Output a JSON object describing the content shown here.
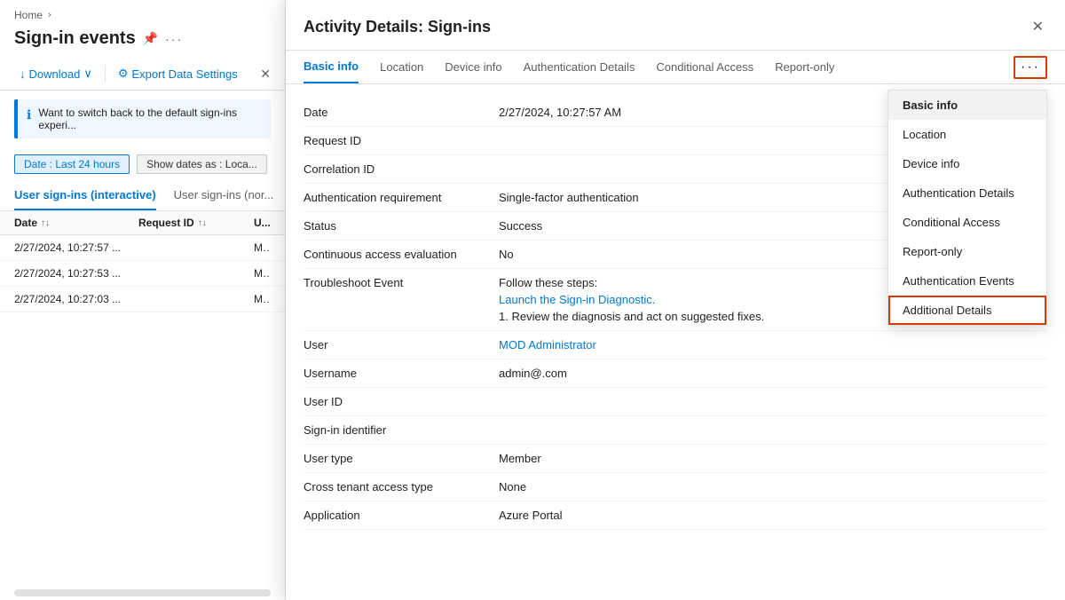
{
  "breadcrumb": {
    "home": "Home",
    "separator": "›"
  },
  "leftPanel": {
    "pageTitle": "Sign-in events",
    "toolbar": {
      "download": "Download",
      "exportDataSettings": "Export Data Settings",
      "close": "✕"
    },
    "infoBanner": "Want to switch back to the default sign-ins experi...",
    "filters": {
      "date": "Date : Last 24 hours",
      "showDates": "Show dates as : Loca..."
    },
    "tabs": [
      {
        "label": "User sign-ins (interactive)",
        "active": true
      },
      {
        "label": "User sign-ins (nor...",
        "active": false
      }
    ],
    "tableHeaders": {
      "date": "Date",
      "requestId": "Request ID",
      "user": "U..."
    },
    "tableRows": [
      {
        "date": "2/27/2024, 10:27:57 ...",
        "requestId": "",
        "user": "M..."
      },
      {
        "date": "2/27/2024, 10:27:53 ...",
        "requestId": "",
        "user": "M..."
      },
      {
        "date": "2/27/2024, 10:27:03 ...",
        "requestId": "",
        "user": "M..."
      }
    ]
  },
  "modal": {
    "title": "Activity Details: Sign-ins",
    "closeLabel": "✕",
    "tabs": [
      {
        "label": "Basic info",
        "active": true
      },
      {
        "label": "Location",
        "active": false
      },
      {
        "label": "Device info",
        "active": false
      },
      {
        "label": "Authentication Details",
        "active": false
      },
      {
        "label": "Conditional Access",
        "active": false
      },
      {
        "label": "Report-only",
        "active": false
      }
    ],
    "moreButton": "···",
    "dropdownItems": [
      {
        "label": "Basic info",
        "active": true,
        "highlighted": false
      },
      {
        "label": "Location",
        "active": false,
        "highlighted": false
      },
      {
        "label": "Device info",
        "active": false,
        "highlighted": false
      },
      {
        "label": "Authentication Details",
        "active": false,
        "highlighted": false
      },
      {
        "label": "Conditional Access",
        "active": false,
        "highlighted": false
      },
      {
        "label": "Report-only",
        "active": false,
        "highlighted": false
      },
      {
        "label": "Authentication Events",
        "active": false,
        "highlighted": false
      },
      {
        "label": "Additional Details",
        "active": false,
        "highlighted": true
      }
    ],
    "fields": [
      {
        "label": "Date",
        "value": "2/27/2024, 10:27:57 AM",
        "type": "text"
      },
      {
        "label": "Request ID",
        "value": "",
        "type": "text"
      },
      {
        "label": "Correlation ID",
        "value": "",
        "type": "text"
      },
      {
        "label": "Authentication requirement",
        "value": "Single-factor authentication",
        "type": "text"
      },
      {
        "label": "Status",
        "value": "Success",
        "type": "text"
      },
      {
        "label": "Continuous access evaluation",
        "value": "No",
        "type": "text"
      },
      {
        "label": "Troubleshoot Event",
        "value": "",
        "type": "troubleshoot",
        "troubleshoot": {
          "steps": "Follow these steps:",
          "link": "Launch the Sign-in Diagnostic.",
          "step1": "1. Review the diagnosis and act on suggested fixes."
        }
      },
      {
        "label": "User",
        "value": "MOD Administrator",
        "type": "link"
      },
      {
        "label": "Username",
        "value": "admin@.com",
        "type": "text"
      },
      {
        "label": "User ID",
        "value": "",
        "type": "text"
      },
      {
        "label": "Sign-in identifier",
        "value": "",
        "type": "text"
      },
      {
        "label": "User type",
        "value": "Member",
        "type": "text"
      },
      {
        "label": "Cross tenant access type",
        "value": "None",
        "type": "text"
      },
      {
        "label": "Application",
        "value": "Azure Portal",
        "type": "text"
      }
    ]
  }
}
